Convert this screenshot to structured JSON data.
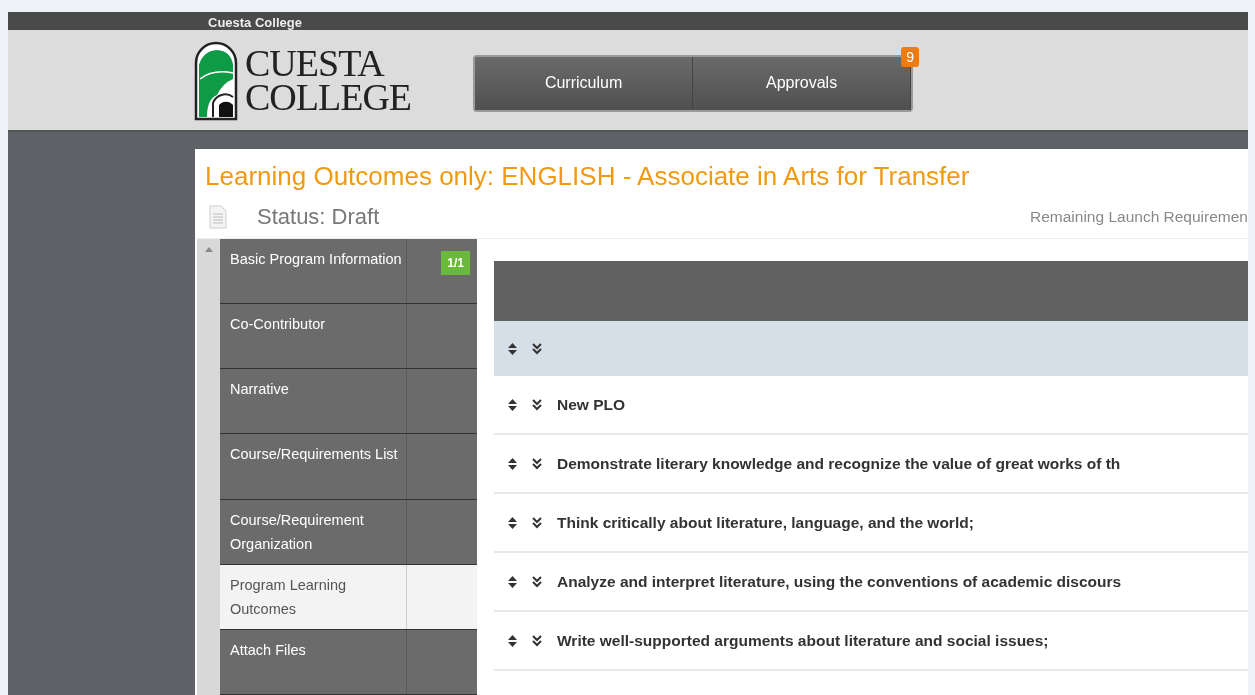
{
  "site_bar": {
    "title": "Cuesta College"
  },
  "logo": {
    "line1": "CUESTA",
    "line2": "COLLEGE"
  },
  "nav": [
    {
      "label": "Curriculum"
    },
    {
      "label": "Approvals",
      "badge": "9"
    }
  ],
  "proposal": {
    "title": "Learning Outcomes only: ENGLISH - Associate in Arts for Transfer",
    "status": "Status: Draft",
    "requirements": "Remaining Launch Requiremen"
  },
  "sidebar": {
    "items": [
      {
        "label": "Basic Program Information",
        "badge": "1/1",
        "selected": false
      },
      {
        "label": "Co-Contributor",
        "selected": false
      },
      {
        "label": "Narrative",
        "selected": false
      },
      {
        "label": "Course/Requirements List",
        "selected": false
      },
      {
        "label": "Course/Requirement Organization",
        "selected": false
      },
      {
        "label": "Program Learning Outcomes",
        "selected": true
      },
      {
        "label": "Attach Files",
        "selected": false
      }
    ]
  },
  "outcomes": [
    {
      "text": "New PLO"
    },
    {
      "text": "Demonstrate literary knowledge and recognize the value of great works of th"
    },
    {
      "text": "Think critically about literature, language, and the world;"
    },
    {
      "text": "Analyze and interpret literature, using the conventions of academic discours"
    },
    {
      "text": "Write well-supported arguments about literature and social issues;"
    }
  ]
}
